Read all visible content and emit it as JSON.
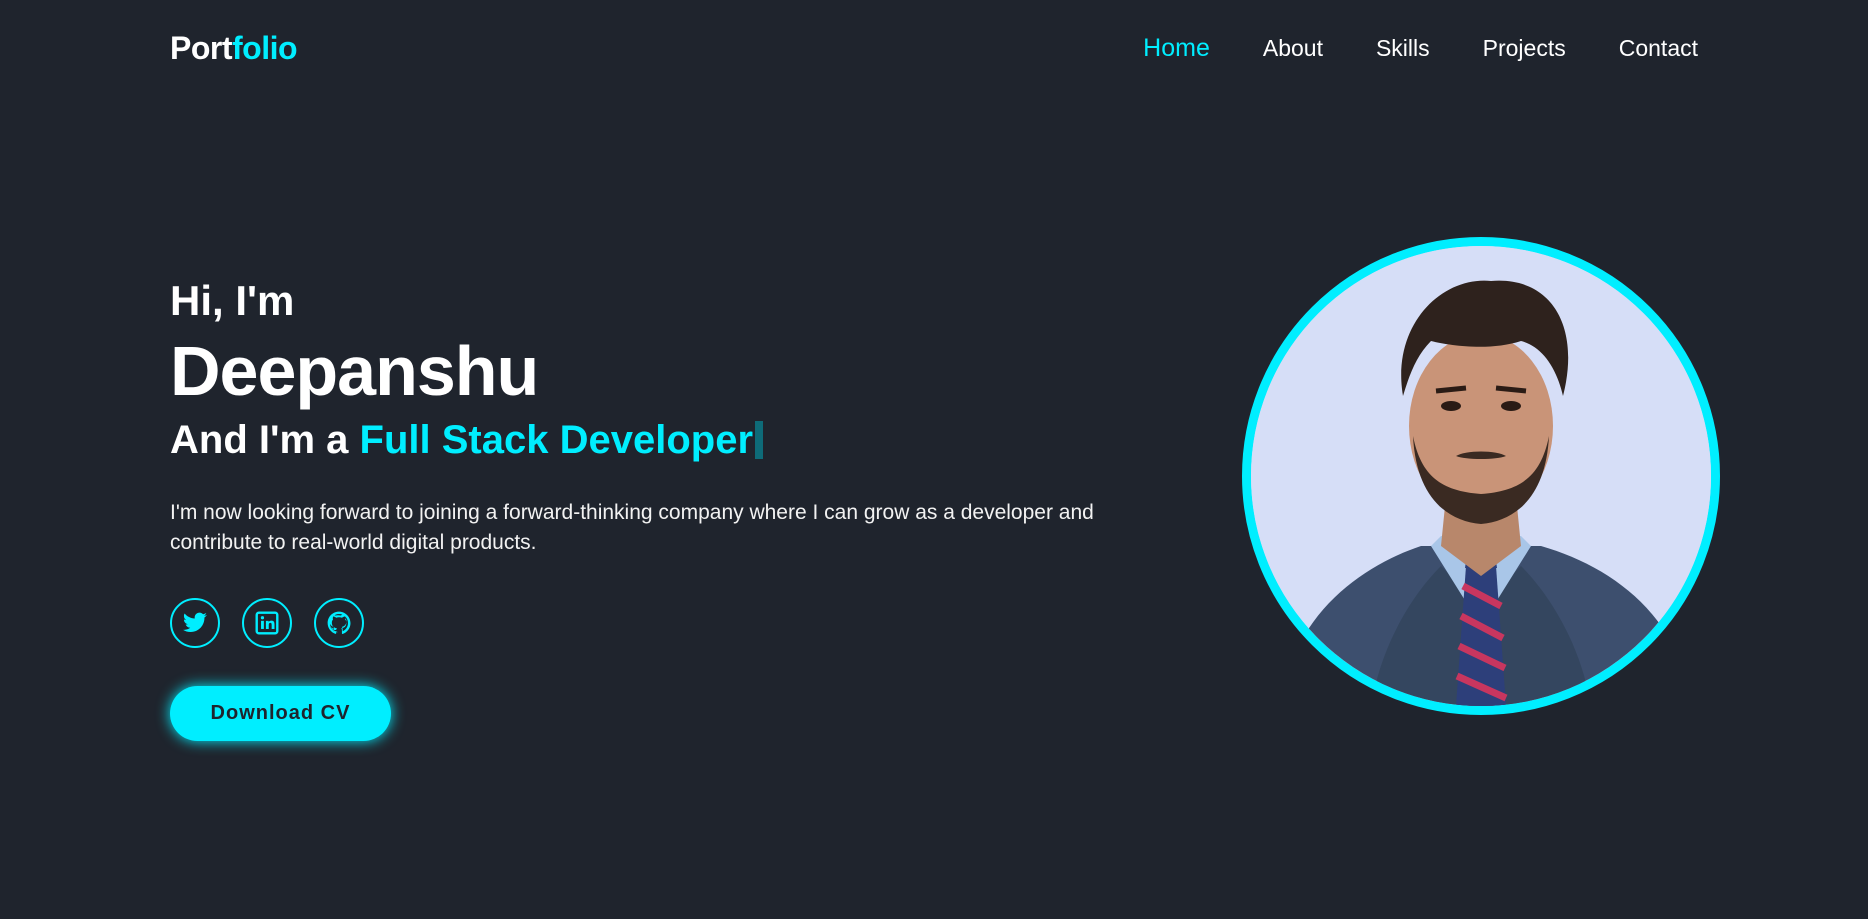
{
  "header": {
    "logo_part1": "Port",
    "logo_part2": "folio",
    "nav": [
      "Home",
      "About",
      "Skills",
      "Projects",
      "Contact"
    ]
  },
  "hero": {
    "greeting": "Hi, I'm",
    "name": "Deepanshu",
    "role_prefix": "And I'm a ",
    "role_typed": "Full Stack Developer",
    "description": "I'm now looking forward to joining a forward-thinking company where I can grow as a developer and contribute to real-world digital products.",
    "socials": [
      "twitter-icon",
      "linkedin-icon",
      "github-icon"
    ],
    "cv_button": "Download CV"
  },
  "colors": {
    "background": "#1f242d",
    "accent": "#00eeff",
    "text": "#ffffff"
  }
}
